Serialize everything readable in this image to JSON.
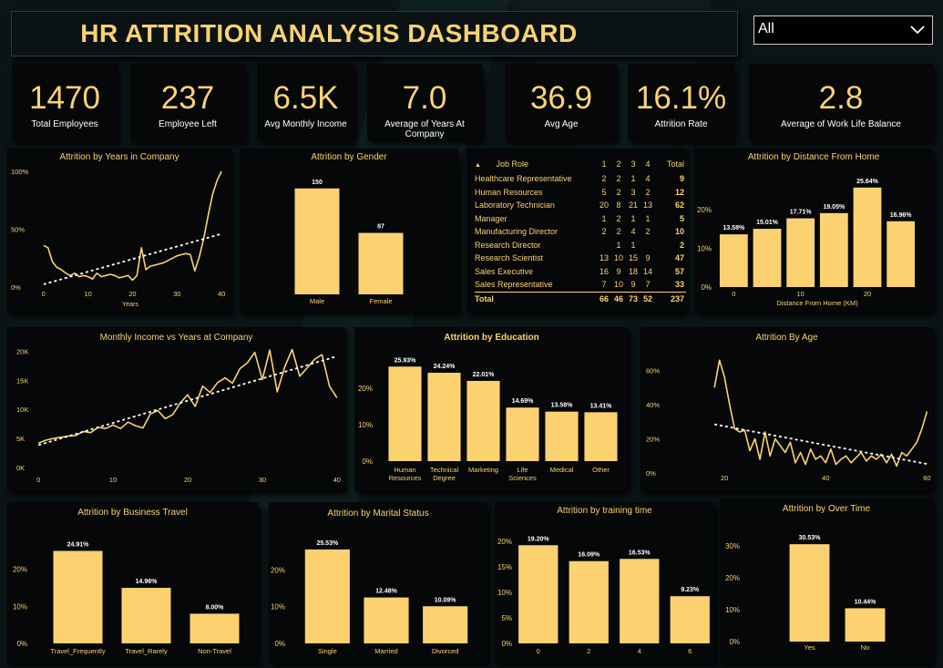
{
  "header": {
    "title": "HR ATTRITION ANALYSIS DASHBOARD"
  },
  "filter": {
    "selected": "All"
  },
  "kpis": [
    {
      "value": "1470",
      "label": "Total Employees"
    },
    {
      "value": "237",
      "label": "Employee Left"
    },
    {
      "value": "6.5K",
      "label": "Avg Monthly Income"
    },
    {
      "value": "7.0",
      "label": "Average of Years At Company"
    },
    {
      "value": "36.9",
      "label": "Avg Age"
    },
    {
      "value": "16.1%",
      "label": "Attrition Rate"
    },
    {
      "value": "2.8",
      "label": "Average of Work Life Balance"
    }
  ],
  "colors": {
    "accent": "#fcd271",
    "bar": "#fcd271",
    "panel": "#050708",
    "background": "#0b1516"
  },
  "job_role_table": {
    "headers": [
      "Job Role",
      "1",
      "2",
      "3",
      "4",
      "Total"
    ],
    "rows": [
      [
        "Healthcare Representative",
        "2",
        "2",
        "1",
        "4",
        "9"
      ],
      [
        "Human Resources",
        "5",
        "2",
        "3",
        "2",
        "12"
      ],
      [
        "Laboratory Technician",
        "20",
        "8",
        "21",
        "13",
        "62"
      ],
      [
        "Manager",
        "1",
        "2",
        "1",
        "1",
        "5"
      ],
      [
        "Manufacturing Director",
        "2",
        "2",
        "4",
        "2",
        "10"
      ],
      [
        "Research Director",
        "",
        "1",
        "1",
        "",
        "2"
      ],
      [
        "Research Scientist",
        "13",
        "10",
        "15",
        "9",
        "47"
      ],
      [
        "Sales Executive",
        "16",
        "9",
        "18",
        "14",
        "57"
      ],
      [
        "Sales Representative",
        "7",
        "10",
        "9",
        "7",
        "33"
      ]
    ],
    "total": [
      "Total",
      "66",
      "46",
      "73",
      "52",
      "237"
    ]
  },
  "chart_data": [
    {
      "id": "years_company",
      "type": "line",
      "title": "Attrition by Years in Company",
      "xlabel": "Years",
      "xlim": [
        -2,
        41
      ],
      "ylim": [
        0,
        100
      ],
      "xticks": [
        0,
        10,
        20,
        30,
        40
      ],
      "yticks": [
        0,
        50,
        100
      ],
      "ytick_labels": [
        "0%",
        "50%",
        "100%"
      ],
      "trendline": true,
      "x": [
        0,
        1,
        2,
        3,
        4,
        5,
        6,
        7,
        8,
        9,
        10,
        11,
        12,
        13,
        14,
        15,
        16,
        17,
        18,
        19,
        20,
        21,
        22,
        23,
        24,
        25,
        26,
        27,
        28,
        29,
        30,
        31,
        32,
        33,
        34,
        35,
        36,
        37,
        38,
        39,
        40
      ],
      "y": [
        36,
        34,
        22,
        17,
        15,
        12,
        10,
        12,
        9,
        10,
        9,
        7,
        12,
        9,
        10,
        11,
        10,
        8,
        9,
        10,
        6,
        10,
        34,
        15,
        18,
        19,
        20,
        21,
        23,
        25,
        27,
        28,
        29,
        28,
        14,
        26,
        42,
        62,
        80,
        92,
        100
      ]
    },
    {
      "id": "gender",
      "type": "bar",
      "title": "Attrition by Gender",
      "categories": [
        "Male",
        "Female"
      ],
      "values": [
        150,
        87
      ],
      "value_labels": [
        "150",
        "87"
      ],
      "ylim": [
        0,
        160
      ]
    },
    {
      "id": "distance",
      "type": "bar",
      "title": "Attrition by Distance From Home",
      "xlabel": "Distance From Home (KM)",
      "categories": [
        "0",
        "5",
        "10",
        "15",
        "20",
        "25"
      ],
      "values": [
        13.58,
        15.01,
        17.71,
        19.05,
        25.64,
        16.96
      ],
      "value_labels": [
        "13.58%",
        "15.01%",
        "17.71%",
        "19.05%",
        "25.64%",
        "16.96%"
      ],
      "shown_tick_labels": [
        "0",
        "",
        "10",
        "",
        "20",
        ""
      ],
      "ylim": [
        0,
        27
      ],
      "yticks": [
        0,
        10,
        20
      ],
      "ytick_labels": [
        "0%",
        "10%",
        "20%"
      ]
    },
    {
      "id": "income",
      "type": "line",
      "title": "Monthly Income vs Years at Company",
      "xlim": [
        -1,
        41
      ],
      "ylim": [
        0,
        21000
      ],
      "xticks": [
        0,
        10,
        20,
        30,
        40
      ],
      "yticks": [
        0,
        5000,
        10000,
        15000,
        20000
      ],
      "ytick_labels": [
        "0K",
        "5K",
        "10K",
        "15K",
        "20K"
      ],
      "trendline": true,
      "x": [
        0,
        1,
        2,
        3,
        4,
        5,
        6,
        7,
        8,
        9,
        10,
        11,
        12,
        13,
        14,
        15,
        16,
        17,
        18,
        19,
        20,
        21,
        22,
        23,
        24,
        25,
        26,
        27,
        28,
        29,
        30,
        31,
        32,
        33,
        34,
        35,
        36,
        37,
        38,
        39,
        40
      ],
      "y": [
        4200,
        4700,
        5000,
        5200,
        5400,
        5500,
        6200,
        6000,
        6900,
        6700,
        7300,
        6700,
        7800,
        7200,
        6800,
        9200,
        9800,
        8400,
        9100,
        11100,
        12500,
        10500,
        14000,
        12900,
        14600,
        15400,
        14500,
        17000,
        18000,
        19800,
        15100,
        20200,
        13000,
        17300,
        20300,
        15700,
        17100,
        18600,
        19400,
        14000,
        12000
      ]
    },
    {
      "id": "education",
      "type": "bar",
      "title": "Attrition by Education",
      "categories": [
        "Human Resources",
        "Technical Degree",
        "Marketing",
        "Life Sciences",
        "Medical",
        "Other"
      ],
      "values": [
        25.93,
        24.24,
        22.01,
        14.69,
        13.58,
        13.41
      ],
      "value_labels": [
        "25.93%",
        "24.24%",
        "22.01%",
        "14.69%",
        "13.58%",
        "13.41%"
      ],
      "ylim": [
        0,
        27
      ],
      "yticks": [
        0,
        10,
        20
      ],
      "ytick_labels": [
        "0%",
        "10%",
        "20%"
      ]
    },
    {
      "id": "age",
      "type": "line",
      "title": "Attrition By Age",
      "xlim": [
        16,
        61
      ],
      "ylim": [
        0,
        72
      ],
      "xticks": [
        20,
        40,
        60
      ],
      "yticks": [
        0,
        20,
        40,
        60
      ],
      "ytick_labels": [
        "0%",
        "20%",
        "40%",
        "60%"
      ],
      "trendline": true,
      "x": [
        18,
        19,
        20,
        21,
        22,
        23,
        24,
        25,
        26,
        27,
        28,
        29,
        30,
        31,
        32,
        33,
        34,
        35,
        36,
        37,
        38,
        39,
        40,
        41,
        42,
        43,
        44,
        45,
        46,
        47,
        48,
        49,
        50,
        51,
        52,
        53,
        54,
        55,
        56,
        57,
        58,
        59,
        60
      ],
      "y": [
        50,
        66,
        56,
        40,
        26,
        24,
        25,
        13,
        20,
        8,
        24,
        10,
        20,
        16,
        12,
        18,
        6,
        12,
        5,
        14,
        8,
        10,
        6,
        14,
        5,
        8,
        10,
        6,
        9,
        12,
        7,
        10,
        8,
        11,
        6,
        11,
        4,
        12,
        10,
        14,
        18,
        26,
        36
      ]
    },
    {
      "id": "travel",
      "type": "bar",
      "title": "Attrition by Business Travel",
      "categories": [
        "Travel_Frequently",
        "Travel_Rarely",
        "Non-Travel"
      ],
      "values": [
        24.91,
        14.96,
        8.0
      ],
      "value_labels": [
        "24.91%",
        "14.96%",
        "8.00%"
      ],
      "ylim": [
        0,
        27
      ],
      "yticks": [
        0,
        10,
        20
      ],
      "ytick_labels": [
        "0%",
        "10%",
        "20%"
      ]
    },
    {
      "id": "marital",
      "type": "bar",
      "title": "Attrition by Marital Status",
      "categories": [
        "Single",
        "Married",
        "Divorced"
      ],
      "values": [
        25.53,
        12.48,
        10.09
      ],
      "value_labels": [
        "25.53%",
        "12.48%",
        "10.09%"
      ],
      "ylim": [
        0,
        27
      ],
      "yticks": [
        0,
        10,
        20
      ],
      "ytick_labels": [
        "0%",
        "10%",
        "20%"
      ]
    },
    {
      "id": "training",
      "type": "bar",
      "title": "Attrition by training time",
      "categories": [
        "0",
        "2",
        "4",
        "6"
      ],
      "values": [
        19.2,
        16.09,
        16.53,
        9.23
      ],
      "value_labels": [
        "19.20%",
        "16.09%",
        "16.53%",
        "9.23%"
      ],
      "ylim": [
        0,
        20.5
      ],
      "yticks": [
        0,
        5,
        10,
        15,
        20
      ],
      "ytick_labels": [
        "0%",
        "5%",
        "10%",
        "15%",
        "20%"
      ]
    },
    {
      "id": "overtime",
      "type": "bar",
      "title": "Attrition by Over Time",
      "categories": [
        "Yes",
        "No"
      ],
      "values": [
        30.53,
        10.44
      ],
      "value_labels": [
        "30.53%",
        "10.44%"
      ],
      "ylim": [
        0,
        32
      ],
      "yticks": [
        0,
        10,
        20,
        30
      ],
      "ytick_labels": [
        "0%",
        "10%",
        "20%",
        "30%"
      ]
    }
  ]
}
